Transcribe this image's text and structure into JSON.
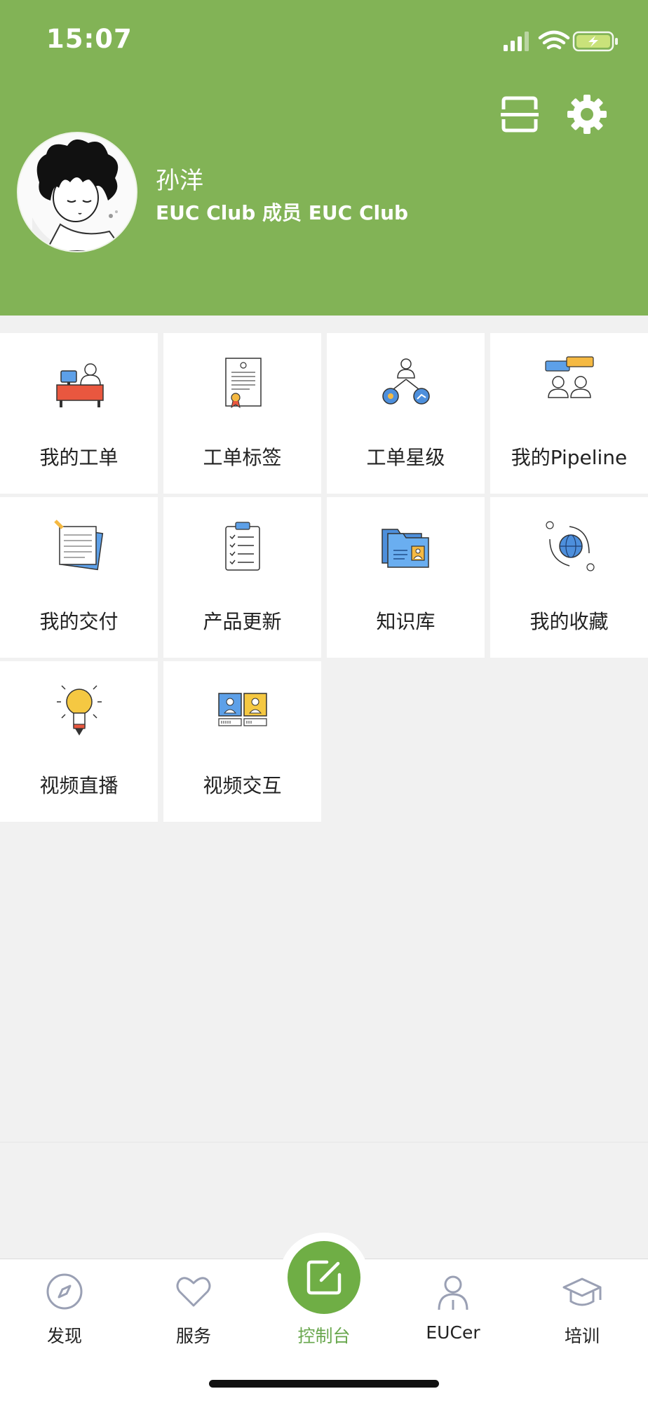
{
  "status": {
    "time": "15:07"
  },
  "user": {
    "name": "孙洋",
    "subtitle": "EUC Club 成员 EUC Club"
  },
  "grid": [
    {
      "label": "我的工单",
      "icon": "desk-icon"
    },
    {
      "label": "工单标签",
      "icon": "certificate-icon"
    },
    {
      "label": "工单星级",
      "icon": "org-icon"
    },
    {
      "label": "我的Pipeline",
      "icon": "chat-people-icon"
    },
    {
      "label": "我的交付",
      "icon": "notes-icon"
    },
    {
      "label": "产品更新",
      "icon": "clipboard-icon"
    },
    {
      "label": "知识库",
      "icon": "folder-icon"
    },
    {
      "label": "我的收藏",
      "icon": "globe-cycle-icon"
    },
    {
      "label": "视频直播",
      "icon": "bulb-icon"
    },
    {
      "label": "视频交互",
      "icon": "id-cards-icon"
    }
  ],
  "tabs": [
    {
      "label": "发现",
      "icon": "compass-icon"
    },
    {
      "label": "服务",
      "icon": "heart-icon"
    },
    {
      "label": "控制台",
      "icon": "edit-icon",
      "active": true
    },
    {
      "label": "EUCer",
      "icon": "person-icon"
    },
    {
      "label": "培训",
      "icon": "graduation-cap-icon"
    }
  ],
  "colors": {
    "header": "#82b356",
    "active_tab": "#6aa84f"
  }
}
